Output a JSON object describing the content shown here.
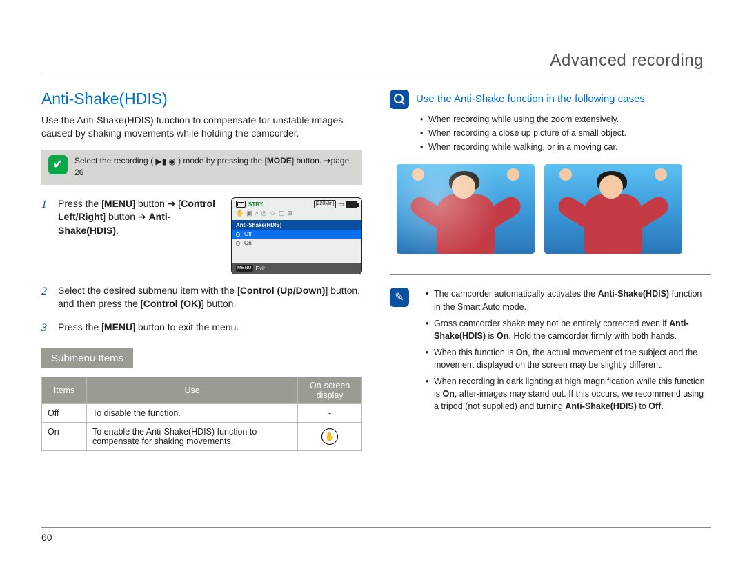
{
  "page": {
    "header": "Advanced recording",
    "number": "60"
  },
  "left": {
    "heading": "Anti-Shake(HDIS)",
    "intro": "Use the Anti-Shake(HDIS) function to compensate for unstable images caused by shaking movements while holding the camcorder.",
    "checknote_pre": "Select the recording (",
    "checknote_post": ") mode by pressing the [",
    "checknote_mode": "MODE",
    "checknote_end": "] button. ",
    "checknote_ref": "➔page 26",
    "steps": {
      "s1_a": "Press the [",
      "s1_menu": "MENU",
      "s1_b": "] button ➔ [",
      "s1_ctrl_lr": "Control Left/Right",
      "s1_c": "] button ➔ ",
      "s1_target": "Anti-Shake(HDIS)",
      "s1_end": ".",
      "s2_a": "Select the desired submenu item with the [",
      "s2_ctrl_ud": "Control (Up/Down)",
      "s2_b": "] button, and then press the [",
      "s2_ctrl_ok": "Control (OK)",
      "s2_c": "] button.",
      "s3": "Press the [",
      "s3_menu": "MENU",
      "s3_end": "] button to exit the menu."
    },
    "lcd": {
      "stby": "STBY",
      "time": "[220Min]",
      "tab": "Anti-Shake(HDIS)",
      "opt_off": "Off",
      "opt_on": "On",
      "footer_menu": "MENU",
      "footer_exit": "Exit"
    },
    "sub_heading": "Submenu Items",
    "table": {
      "h1": "Items",
      "h2": "Use",
      "h3": "On-screen display",
      "r1c1": "Off",
      "r1c2": "To disable the function.",
      "r1c3": "-",
      "r2c1": "On",
      "r2c2": "To enable the Anti-Shake(HDIS) function to compensate for shaking movements.",
      "r2c3": "✋"
    }
  },
  "right": {
    "cases_heading": "Use the Anti-Shake function in the following cases",
    "cases": {
      "c1": "When recording while using the zoom extensively.",
      "c2": "When recording a close up picture of a small object.",
      "c3": "When recording while walking, or in a moving car."
    },
    "notes": {
      "n1_a": "The camcorder automatically activates the ",
      "n1_b": "Anti-Shake(HDIS)",
      "n1_c": " function in the Smart Auto mode.",
      "n2_a": "Gross camcorder shake may not be entirely corrected even if ",
      "n2_b": "Anti-Shake(HDIS)",
      "n2_c": " is ",
      "n2_d": "On",
      "n2_e": ". Hold the camcorder firmly with both hands.",
      "n3_a": "When this function is ",
      "n3_b": "On",
      "n3_c": ", the actual movement of the subject and the movement displayed on the screen may be slightly different.",
      "n4_a": "When recording in dark lighting at high magnification while this function is ",
      "n4_b": "On",
      "n4_c": ", after-images may stand out. If this occurs, we recommend using a tripod (not supplied) and turning ",
      "n4_d": "Anti-Shake(HDIS)",
      "n4_e": " to ",
      "n4_f": "Off",
      "n4_g": "."
    }
  }
}
